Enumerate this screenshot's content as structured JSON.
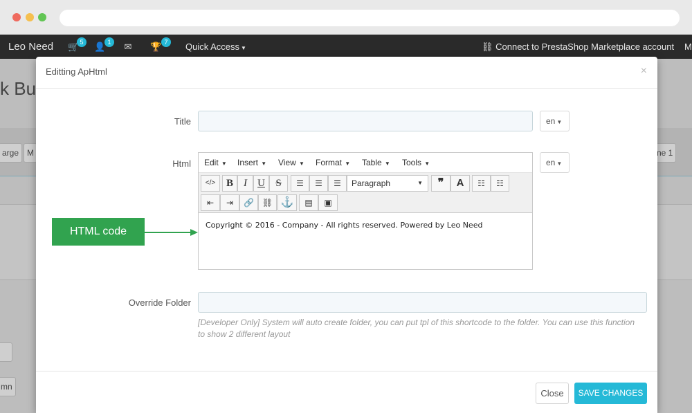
{
  "navbar": {
    "brand": "Leo Need",
    "cart_count": "5",
    "customers_count": "1",
    "messages_count": "",
    "trophy_count": "7",
    "quick_access": "Quick Access",
    "connect_link": "Connect to PrestaShop Marketplace account",
    "more": "M"
  },
  "background": {
    "title_fragment": "k Bui",
    "btn_left_1": "arge",
    "btn_left_2": "M",
    "btn_right": "ne 1",
    "btn_bottom": "mn"
  },
  "modal": {
    "title": "Editting ApHtml",
    "close": "×",
    "title_label": "Title",
    "title_value": "",
    "title_lang": "en",
    "html_label": "Html",
    "html_lang": "en",
    "editor": {
      "menu": [
        "Edit",
        "Insert",
        "View",
        "Format",
        "Table",
        "Tools"
      ],
      "format_select": "Paragraph",
      "content": "Copyright © 2016 - Company - All rights reserved. Powered by Leo Need"
    },
    "override_label": "Override Folder",
    "override_value": "",
    "override_help": "[Developer Only] System will auto create folder, you can put tpl of this shortcode to the folder. You can use this function to show 2 different layout",
    "close_button": "Close",
    "save_button": "SAVE CHANGES"
  },
  "annotation": {
    "label": "HTML code",
    "color": "#31a34f"
  },
  "colors": {
    "accent": "#25b9d7",
    "navbar": "#2a2a2a"
  }
}
